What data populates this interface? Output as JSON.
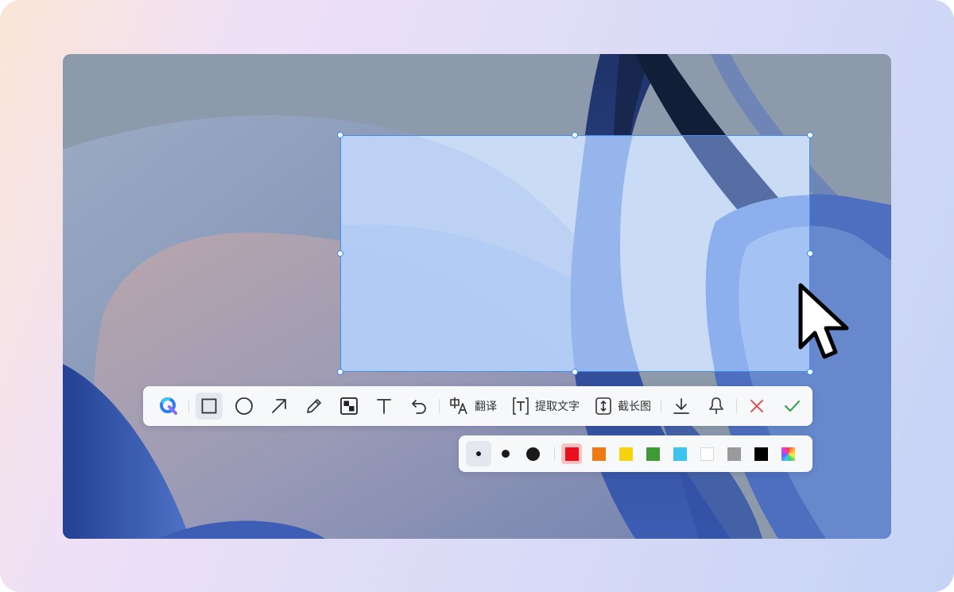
{
  "toolbar": {
    "tools": [
      {
        "id": "app-logo",
        "icon": "app-logo-icon"
      },
      {
        "id": "rectangle",
        "icon": "rectangle-icon",
        "active": true
      },
      {
        "id": "ellipse",
        "icon": "circle-icon"
      },
      {
        "id": "arrow",
        "icon": "arrow-icon"
      },
      {
        "id": "pen",
        "icon": "pencil-icon"
      },
      {
        "id": "mosaic",
        "icon": "mosaic-icon"
      },
      {
        "id": "text",
        "icon": "text-icon"
      },
      {
        "id": "undo",
        "icon": "undo-icon"
      }
    ],
    "translate_label": "翻译",
    "extract_text_label": "提取文字",
    "long_screenshot_label": "截长图",
    "actions": [
      {
        "id": "download",
        "icon": "download-icon"
      },
      {
        "id": "pin",
        "icon": "pin-icon"
      },
      {
        "id": "cancel",
        "icon": "close-icon",
        "color": "#e5484d"
      },
      {
        "id": "confirm",
        "icon": "check-icon",
        "color": "#2e9e4a"
      }
    ]
  },
  "palette": {
    "sizes": [
      "small",
      "medium",
      "large"
    ],
    "selected_size": "small",
    "colors": [
      "#e8101e",
      "#ee7a12",
      "#f5d20a",
      "#3f9a35",
      "#3cc4ee",
      "#ffffff",
      "#9a9a9a",
      "#000000",
      "rainbow"
    ],
    "selected_color": "#e8101e"
  },
  "accent": "#3d8ef0"
}
